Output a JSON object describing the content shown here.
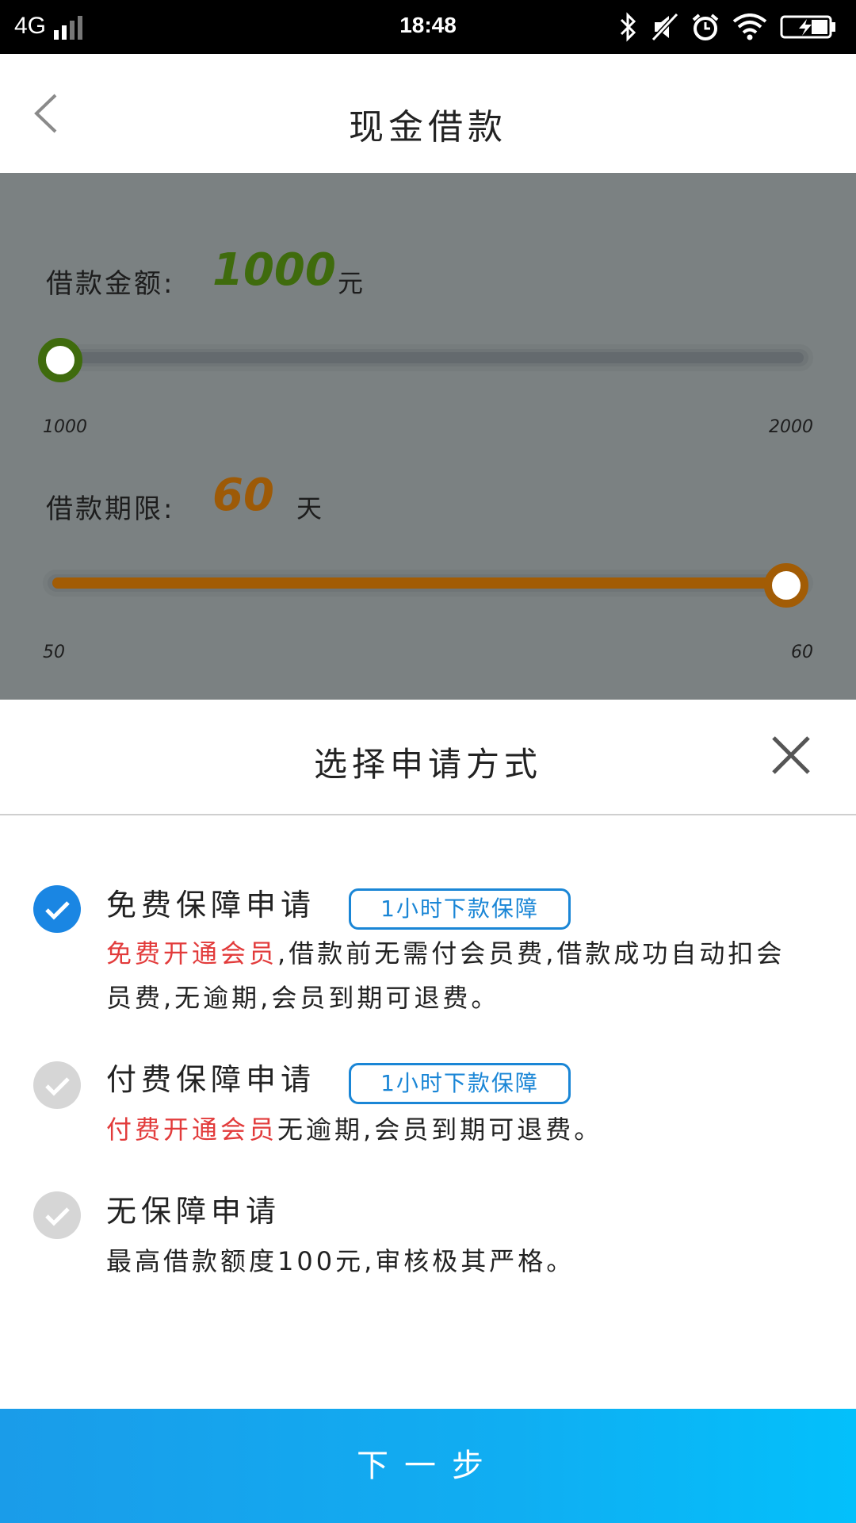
{
  "status_bar": {
    "network": "4G",
    "time": "18:48",
    "icons": [
      "bluetooth-icon",
      "mute-icon",
      "alarm-icon",
      "wifi-icon",
      "battery-charging-icon"
    ]
  },
  "header": {
    "back_icon": "chevron-left-icon",
    "title": "现金借款"
  },
  "amount": {
    "label": "借款金额:",
    "value": "1000",
    "unit": "元",
    "min_label": "1000",
    "max_label": "2000",
    "min": 1000,
    "max": 2000,
    "current": 1000,
    "color": "#3f6b0d"
  },
  "term": {
    "label": "借款期限:",
    "value": "60",
    "unit": "天",
    "min_label": "50",
    "max_label": "60",
    "min": 50,
    "max": 60,
    "current": 60,
    "color": "#a25c05"
  },
  "sheet": {
    "title": "选择申请方式",
    "close_icon": "close-icon",
    "options": [
      {
        "title": "免费保障申请",
        "badge": "1小时下款保障",
        "desc_highlight": "免费开通会员",
        "desc_rest": ",借款前无需付会员费,借款成功自动扣会员费,无逾期,会员到期可退费。",
        "selected": true
      },
      {
        "title": "付费保障申请",
        "badge": "1小时下款保障",
        "desc_highlight": "付费开通会员",
        "desc_rest": "无逾期,会员到期可退费。",
        "selected": false
      },
      {
        "title": "无保障申请",
        "badge": "",
        "desc_highlight": "",
        "desc_rest": "最高借款额度100元,审核极其严格。",
        "selected": false
      }
    ]
  },
  "next_button": {
    "label": "下一步"
  },
  "colors": {
    "check_selected": "#1a86e3",
    "check_unselected": "#d6d6d6",
    "badge": "#1a86d6",
    "highlight_red": "#e23b3b",
    "overlay": "#7b8182"
  }
}
